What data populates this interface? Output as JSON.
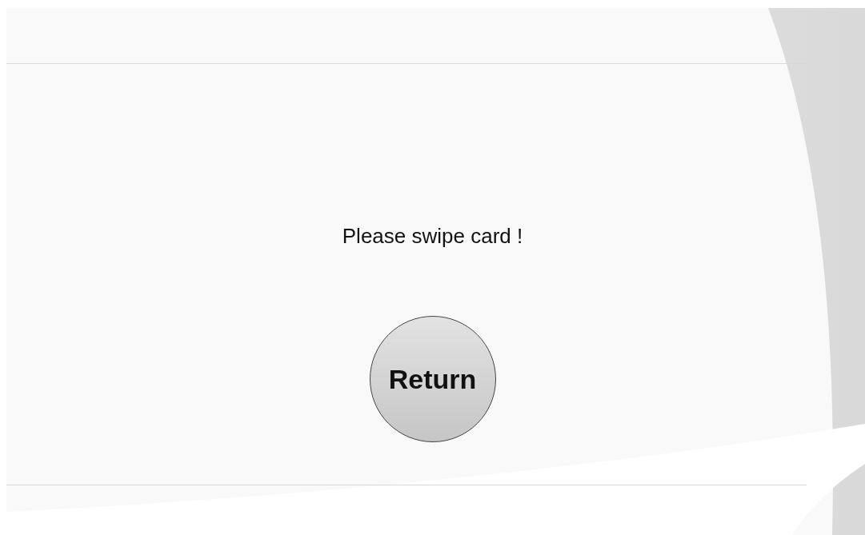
{
  "message": "Please swipe card !",
  "return_button": {
    "label": "Return"
  }
}
